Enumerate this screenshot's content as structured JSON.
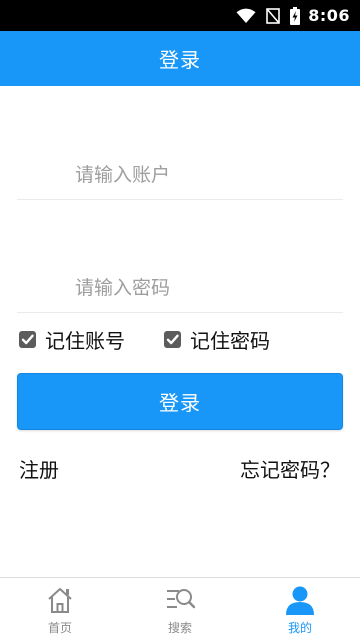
{
  "status_bar": {
    "time": "8:06",
    "icons": [
      "wifi-icon",
      "no-signal-icon",
      "battery-charging-icon"
    ]
  },
  "header": {
    "title": "登录"
  },
  "form": {
    "account_placeholder": "请输入账户",
    "account_value": "",
    "password_placeholder": "请输入密码",
    "password_value": "",
    "remember_account": {
      "label": "记住账号",
      "checked": true
    },
    "remember_password": {
      "label": "记住密码",
      "checked": true
    },
    "login_button_label": "登录",
    "register_link": "注册",
    "forgot_password_link": "忘记密码？"
  },
  "bottom_nav": {
    "items": [
      {
        "label": "首页",
        "icon": "home-icon",
        "active": false
      },
      {
        "label": "搜索",
        "icon": "search-icon",
        "active": false
      },
      {
        "label": "我的",
        "icon": "user-icon",
        "active": true
      }
    ]
  },
  "colors": {
    "primary": "#1997f8",
    "inactive_nav": "#8a8a8a",
    "checkbox": "#5c5c5c"
  }
}
